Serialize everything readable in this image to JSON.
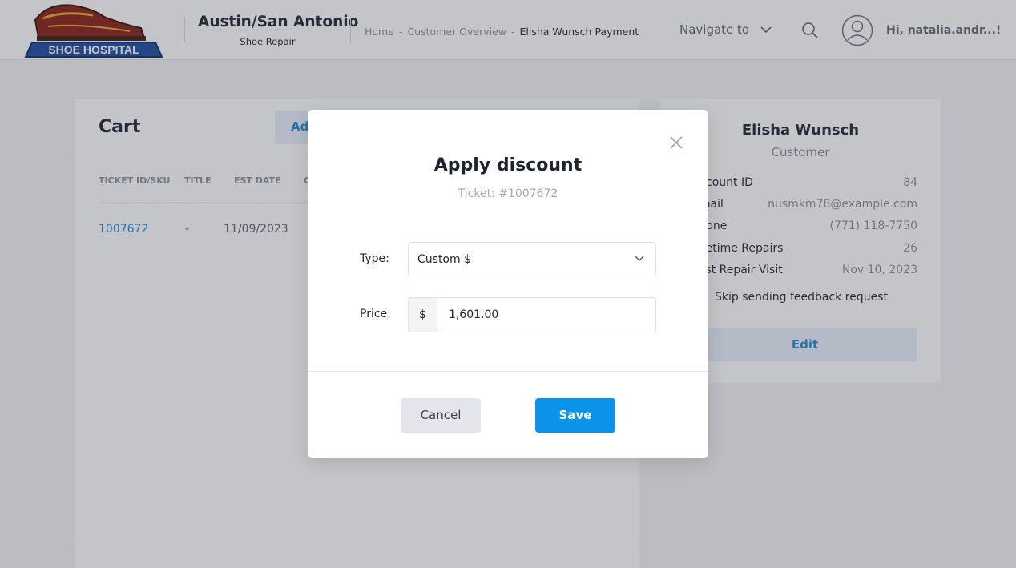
{
  "header": {
    "logo_text": "SHOE HOSPITAL",
    "store_name": "Austin/San Antonio",
    "store_subtitle": "Shoe Repair",
    "breadcrumb": {
      "home": "Home",
      "sep1": "-",
      "customer_overview": "Customer Overview",
      "sep2": "-",
      "current": "Elisha Wunsch Payment"
    },
    "navigate_label": "Navigate to",
    "greeting": "Hi, natalia.andr...!"
  },
  "cart": {
    "title": "Cart",
    "add_button": "Add",
    "columns": [
      "TICKET ID/SKU",
      "TITLE",
      "EST DATE",
      "C"
    ],
    "rows": [
      {
        "ticket_id": "1007672",
        "title": "-",
        "est_date": "11/09/2023"
      }
    ]
  },
  "customer": {
    "name": "Elisha Wunsch",
    "role": "Customer",
    "fields": [
      {
        "label": "Account ID",
        "value": "84"
      },
      {
        "label": "Email",
        "value": "nusmkm78@example.com"
      },
      {
        "label": "Phone",
        "value": "(771) 118-7750"
      },
      {
        "label": "Lifetime Repairs",
        "value": "26"
      },
      {
        "label": "Last Repair Visit",
        "value": "Nov 10, 2023"
      }
    ],
    "skip_feedback_label": "Skip sending feedback request",
    "edit_button": "Edit"
  },
  "modal": {
    "title": "Apply discount",
    "subtitle": "Ticket: #1007672",
    "type_label": "Type:",
    "type_value": "Custom $",
    "price_label": "Price:",
    "price_prefix": "$",
    "price_value": "1,601.00",
    "cancel_button": "Cancel",
    "save_button": "Save"
  },
  "colors": {
    "accent": "#0a93e8",
    "link": "#1d8ad8",
    "text": "#1e2231",
    "muted": "#8a8f9c"
  }
}
